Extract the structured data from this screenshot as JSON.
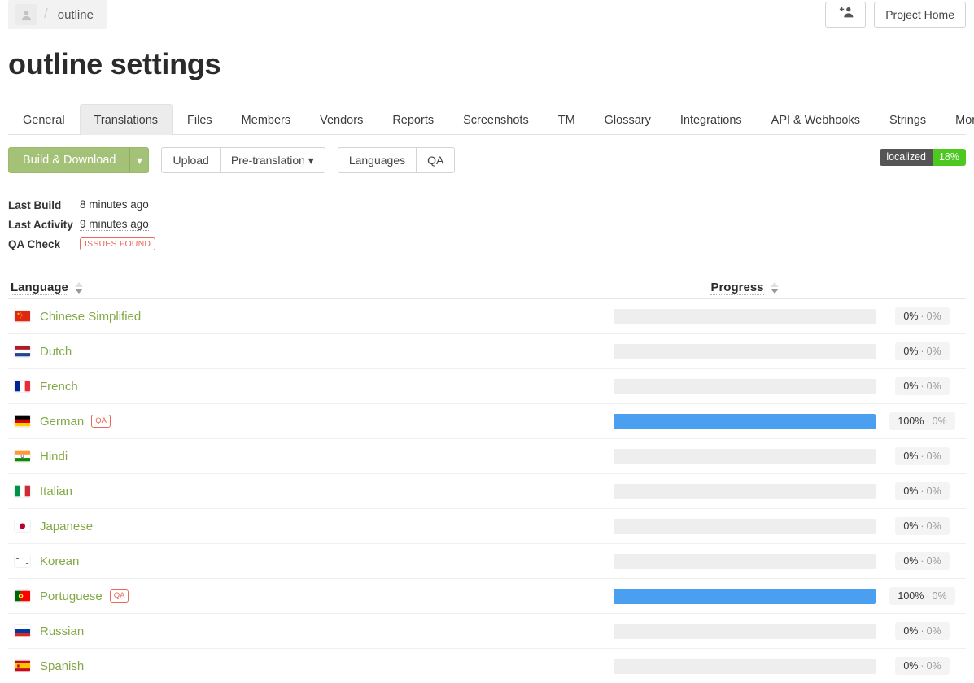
{
  "breadcrumb": {
    "avatar_icon": "person-icon",
    "separator": "/",
    "project": "outline"
  },
  "header": {
    "add_member_icon": "add-person-icon",
    "project_home_label": "Project Home",
    "page_title": "outline settings"
  },
  "tabs": [
    {
      "label": "General",
      "active": false
    },
    {
      "label": "Translations",
      "active": true
    },
    {
      "label": "Files",
      "active": false
    },
    {
      "label": "Members",
      "active": false
    },
    {
      "label": "Vendors",
      "active": false
    },
    {
      "label": "Reports",
      "active": false
    },
    {
      "label": "Screenshots",
      "active": false
    },
    {
      "label": "TM",
      "active": false
    },
    {
      "label": "Glossary",
      "active": false
    },
    {
      "label": "Integrations",
      "active": false
    },
    {
      "label": "API & Webhooks",
      "active": false
    },
    {
      "label": "Strings",
      "active": false
    },
    {
      "label": "More",
      "active": false,
      "caret": true
    }
  ],
  "toolbar": {
    "build_download_label": "Build & Download",
    "build_caret": "▾",
    "upload_label": "Upload",
    "pretranslation_label": "Pre-translation",
    "pretranslation_caret": "▾",
    "languages_label": "Languages",
    "qa_label": "QA",
    "localized_badge": {
      "label": "localized",
      "value": "18%",
      "label_color": "#555555",
      "value_color": "#4dc820"
    }
  },
  "meta": [
    {
      "label": "Last Build",
      "value": "8 minutes ago",
      "type": "link"
    },
    {
      "label": "Last Activity",
      "value": "9 minutes ago",
      "type": "link"
    },
    {
      "label": "QA Check",
      "value": "ISSUES FOUND",
      "type": "badge",
      "badge_color": "#e8685a"
    }
  ],
  "table": {
    "columns": [
      {
        "label": "Language",
        "sortable": true
      },
      {
        "label": "Progress",
        "sortable": true
      }
    ],
    "rows": [
      {
        "language": "Chinese Simplified",
        "flag": "flag-cn",
        "qa": false,
        "progress": 0,
        "translated": "0%",
        "approved": "0%"
      },
      {
        "language": "Dutch",
        "flag": "flag-nl",
        "qa": false,
        "progress": 0,
        "translated": "0%",
        "approved": "0%"
      },
      {
        "language": "French",
        "flag": "flag-fr",
        "qa": false,
        "progress": 0,
        "translated": "0%",
        "approved": "0%"
      },
      {
        "language": "German",
        "flag": "flag-de",
        "qa": true,
        "qa_label": "QA",
        "progress": 100,
        "translated": "100%",
        "approved": "0%"
      },
      {
        "language": "Hindi",
        "flag": "flag-in",
        "qa": false,
        "progress": 0,
        "translated": "0%",
        "approved": "0%"
      },
      {
        "language": "Italian",
        "flag": "flag-it",
        "qa": false,
        "progress": 0,
        "translated": "0%",
        "approved": "0%"
      },
      {
        "language": "Japanese",
        "flag": "flag-jp",
        "qa": false,
        "progress": 0,
        "translated": "0%",
        "approved": "0%"
      },
      {
        "language": "Korean",
        "flag": "flag-kr",
        "qa": false,
        "progress": 0,
        "translated": "0%",
        "approved": "0%"
      },
      {
        "language": "Portuguese",
        "flag": "flag-pt",
        "qa": true,
        "qa_label": "QA",
        "progress": 100,
        "translated": "100%",
        "approved": "0%"
      },
      {
        "language": "Russian",
        "flag": "flag-ru",
        "qa": false,
        "progress": 0,
        "translated": "0%",
        "approved": "0%"
      },
      {
        "language": "Spanish",
        "flag": "flag-es",
        "qa": false,
        "progress": 0,
        "translated": "0%",
        "approved": "0%"
      }
    ],
    "separator": "·"
  },
  "colors": {
    "primary_green": "#a4c178",
    "link_green": "#83a846",
    "progress_blue": "#4a9ff0",
    "danger_red": "#e8685a",
    "badge_green": "#4dc820"
  }
}
